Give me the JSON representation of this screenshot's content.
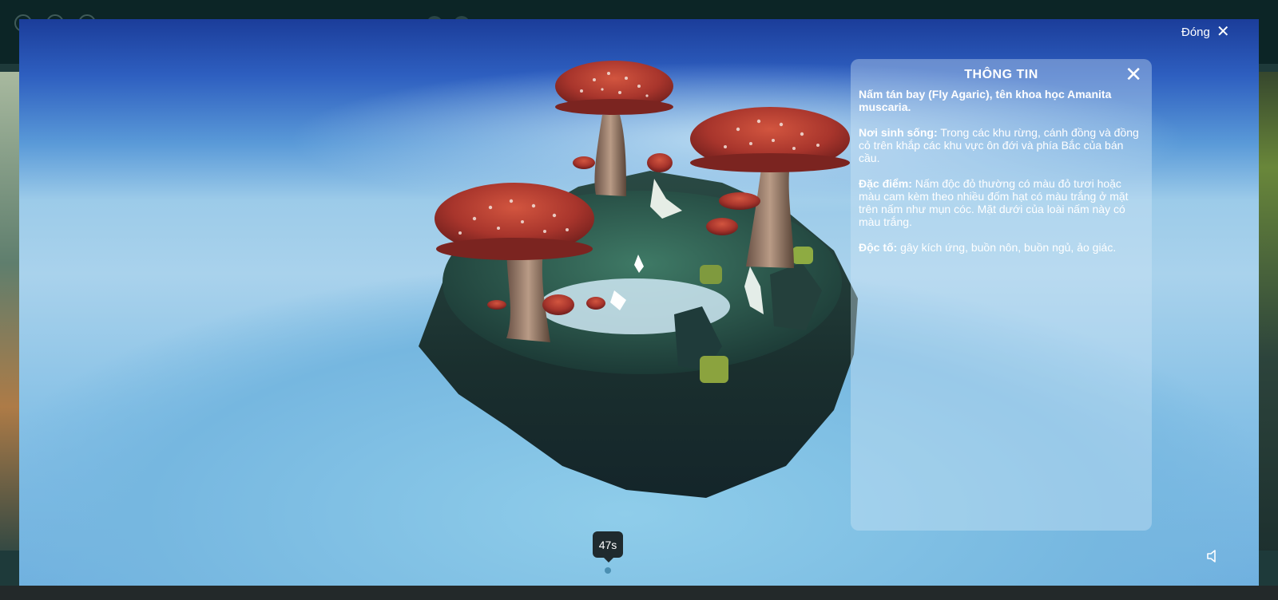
{
  "modal": {
    "close_label": "Đóng",
    "close_icon": "close-icon"
  },
  "info": {
    "title": "THÔNG TIN",
    "intro": "Nấm tán bay (Fly Agaric), tên khoa học Amanita muscaria.",
    "habitat_label": "Nơi sinh sống:",
    "habitat_text": " Trong các khu rừng, cánh đồng và đồng cỏ trên khắp các khu vực ôn đới và phía Bắc của bán cầu.",
    "features_label": "Đặc điểm:",
    "features_text": " Nấm độc đỏ thường có màu đỏ tươi hoặc màu cam kèm theo nhiều đốm hạt có màu trắng ở mặt trên nấm như mụn cóc. Mặt dưới của loài nấm này có màu trắng.",
    "toxicity_label": "Độc tố:",
    "toxicity_text": " gây kích ứng, buồn nôn, buồn ngủ, ảo giác."
  },
  "timer": {
    "value": "47s"
  },
  "icons": {
    "sound": "speaker-icon"
  }
}
